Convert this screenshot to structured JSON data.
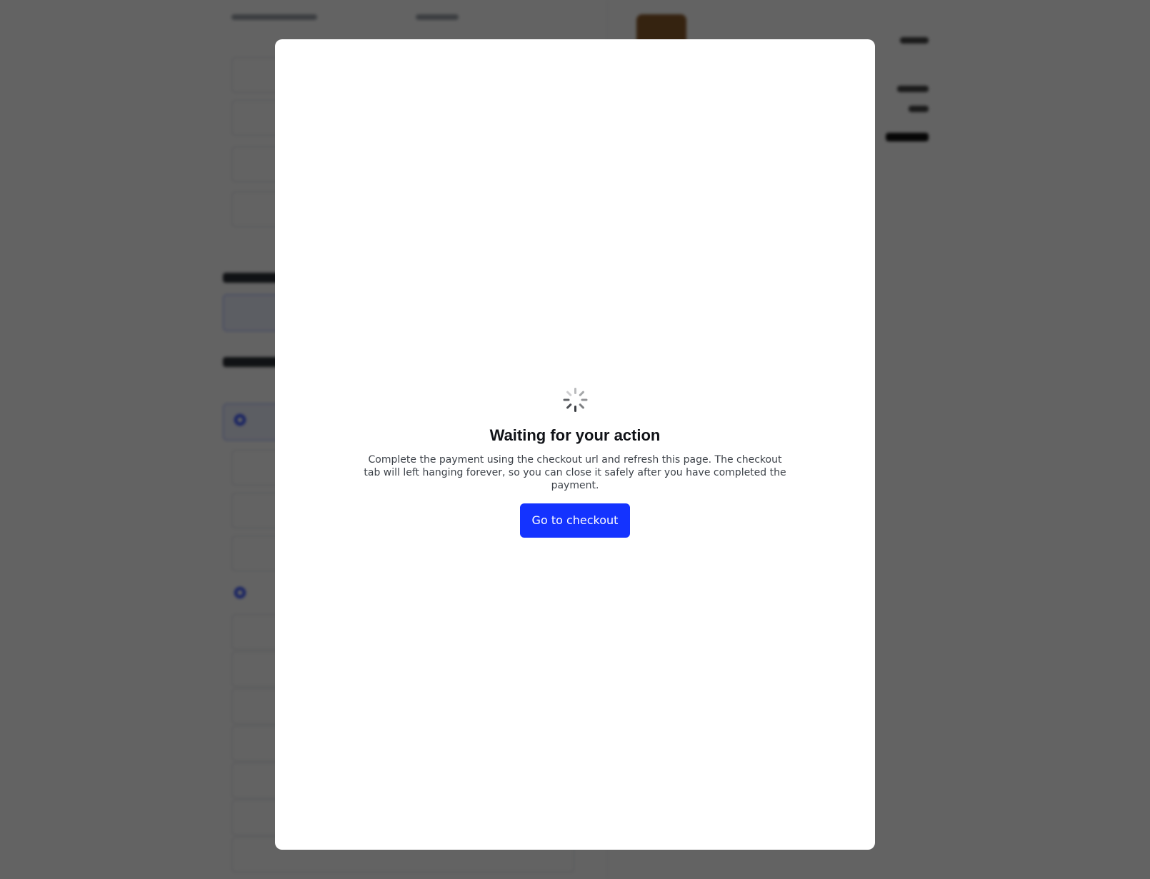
{
  "dialog": {
    "title": "Waiting for your action",
    "description": "Complete the payment using the checkout url and refresh this page. The checkout tab will left hanging forever, so you can close it safely after you have completed the payment.",
    "checkout_button_label": "Go to checkout",
    "spinner_icon": "loading-spinner-icon"
  },
  "colors": {
    "accent": "#1433ff",
    "overlay": "rgba(0,0,0,0.61)",
    "title": "#111318"
  }
}
